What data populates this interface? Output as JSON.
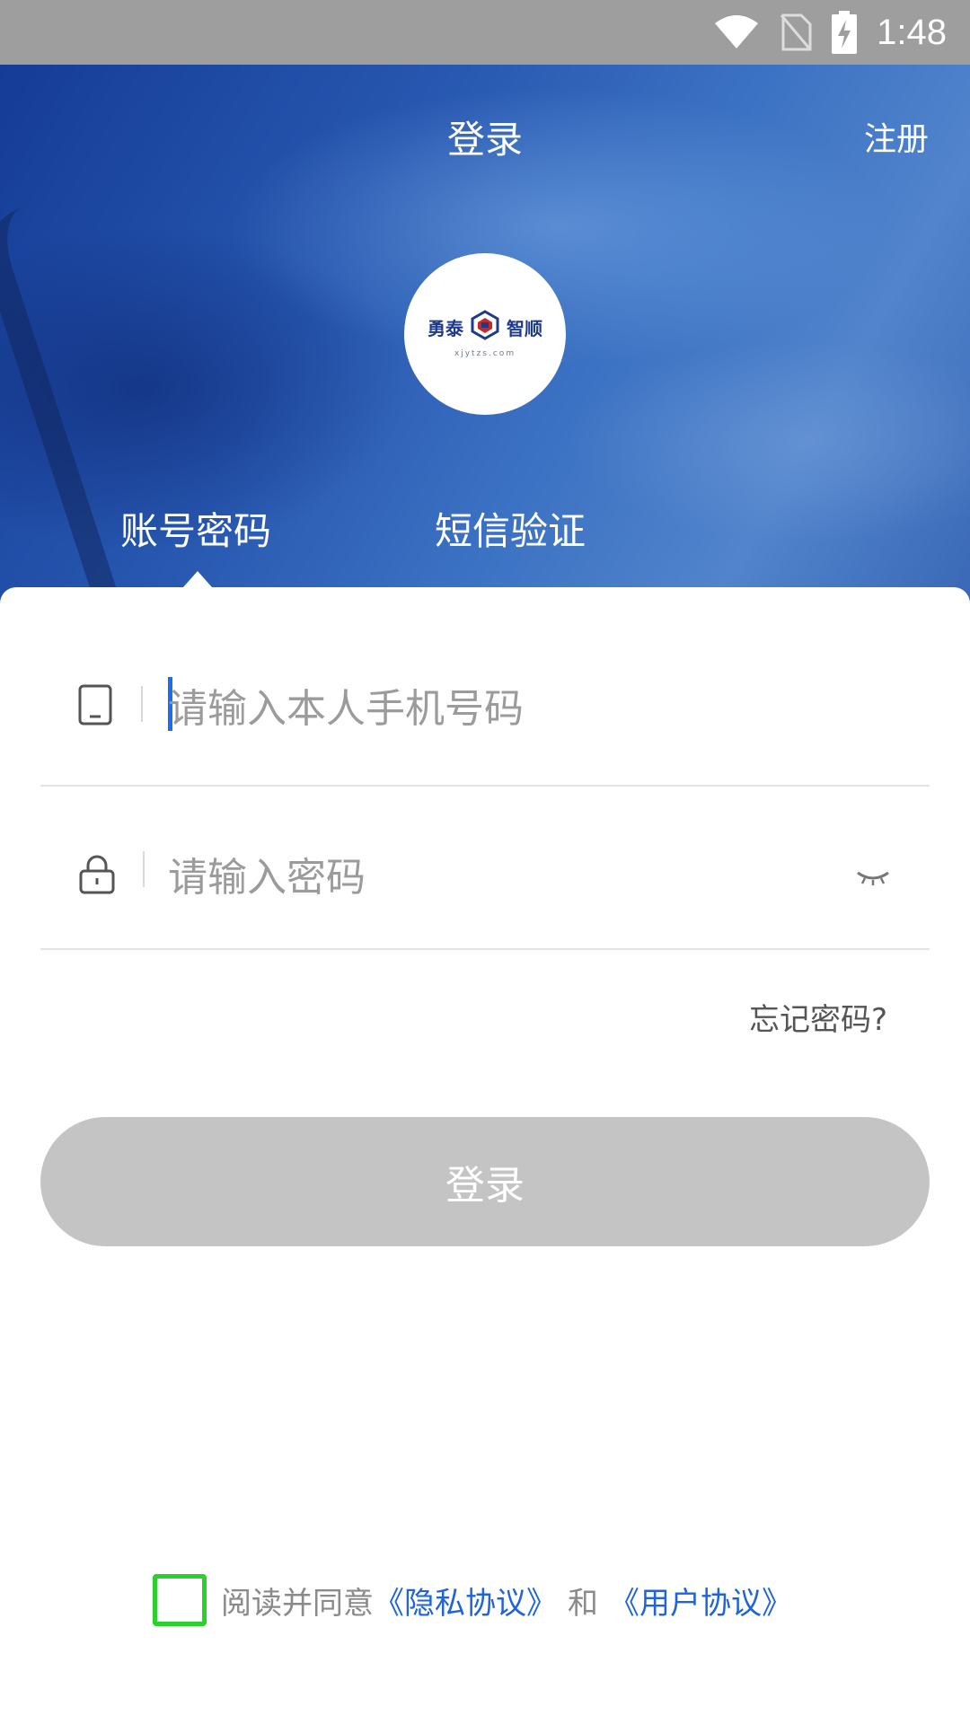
{
  "status_bar": {
    "time": "1:48"
  },
  "header": {
    "title": "登录",
    "register_label": "注册"
  },
  "logo": {
    "left_text": "勇泰",
    "right_text": "智顺",
    "subtitle": "xjytzs.com"
  },
  "tabs": [
    {
      "label": "账号密码",
      "active": true
    },
    {
      "label": "短信验证",
      "active": false
    }
  ],
  "form": {
    "phone": {
      "placeholder": "请输入本人手机号码",
      "value": ""
    },
    "password": {
      "placeholder": "请输入密码",
      "value": ""
    },
    "forgot_label": "忘记密码?",
    "login_label": "登录"
  },
  "agreement": {
    "prefix": "阅读并同意",
    "privacy_link": "《隐私协议》",
    "and": "和",
    "user_link": "《用户协议》",
    "checked": false
  },
  "colors": {
    "accent_blue": "#1f64d8",
    "checkbox_green": "#2bd12b",
    "button_disabled": "#c4c4c4"
  },
  "icons": [
    "wifi-icon",
    "no-sim-icon",
    "battery-charging-icon",
    "phone-icon",
    "lock-icon",
    "eye-closed-icon"
  ]
}
